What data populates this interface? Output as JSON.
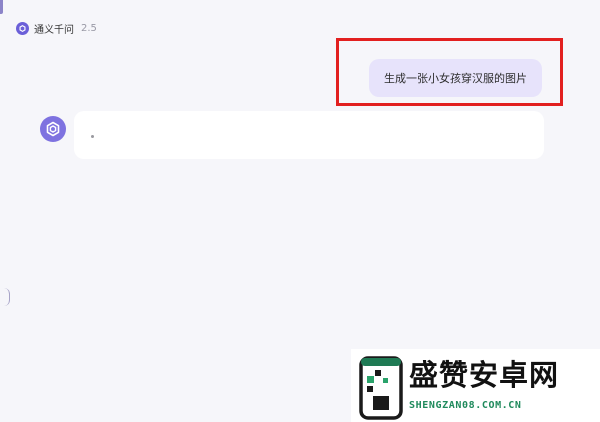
{
  "header": {
    "title": "通义千问",
    "version": "2.5"
  },
  "conversation": {
    "user_message": "生成一张小女孩穿汉服的图片",
    "ai_response": "."
  },
  "watermark": {
    "name": "盛赞安卓网",
    "url": "SHENGZAN08.COM.CN"
  },
  "colors": {
    "background": "#f6f6fa",
    "brand": "#7e72e0",
    "user_bubble": "#e7e3fb",
    "highlight": "#e21f1f",
    "watermark_url": "#1f8a5c"
  }
}
